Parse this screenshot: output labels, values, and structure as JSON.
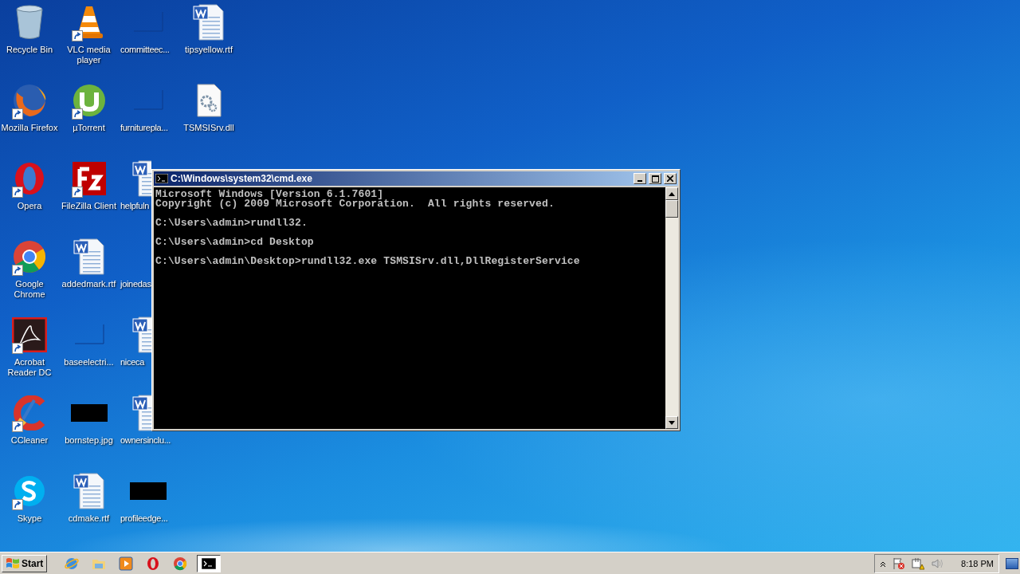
{
  "desktop": {
    "columns": [
      [
        {
          "label": "Recycle Bin",
          "kind": "recycle",
          "shortcut": false
        },
        {
          "label": "Mozilla Firefox",
          "kind": "firefox",
          "shortcut": true
        },
        {
          "label": "Opera",
          "kind": "opera",
          "shortcut": true
        },
        {
          "label": "Google Chrome",
          "kind": "chrome",
          "shortcut": true
        },
        {
          "label": "Acrobat Reader DC",
          "kind": "acrobat",
          "shortcut": true
        },
        {
          "label": "CCleaner",
          "kind": "ccleaner",
          "shortcut": true
        },
        {
          "label": "Skype",
          "kind": "skype",
          "shortcut": true
        }
      ],
      [
        {
          "label": "VLC media player",
          "kind": "vlc",
          "shortcut": true
        },
        {
          "label": "µTorrent",
          "kind": "utorrent",
          "shortcut": true
        },
        {
          "label": "FileZilla Client",
          "kind": "filezilla",
          "shortcut": true
        },
        {
          "label": "addedmark.rtf",
          "kind": "word",
          "shortcut": false
        },
        {
          "label": "baseelectri...",
          "kind": "blank",
          "shortcut": false
        },
        {
          "label": "bornstep.jpg",
          "kind": "image",
          "shortcut": false
        },
        {
          "label": "cdmake.rtf",
          "kind": "word",
          "shortcut": false
        }
      ],
      [
        {
          "label": "committeec...",
          "kind": "blank",
          "shortcut": false
        },
        {
          "label": "furniturepla...",
          "kind": "blank",
          "shortcut": false
        },
        {
          "label": "helpfuln",
          "kind": "word",
          "shortcut": false
        },
        {
          "label": "joinedas",
          "shortcut": false
        },
        {
          "label": "niceca",
          "kind": "word",
          "shortcut": false
        },
        {
          "label": "ownersinclu...",
          "kind": "word",
          "shortcut": false
        },
        {
          "label": "profileedge...",
          "kind": "image",
          "shortcut": false
        }
      ],
      [
        {
          "label": "tipsyellow.rtf",
          "kind": "word",
          "shortcut": false
        },
        {
          "label": "TSMSISrv.dll",
          "kind": "dll",
          "shortcut": false
        }
      ]
    ]
  },
  "console_window": {
    "title": "C:\\Windows\\system32\\cmd.exe",
    "blocks": [
      [
        "Microsoft Windows [Version 6.1.7601]",
        "Copyright (c) 2009 Microsoft Corporation.  All rights reserved."
      ],
      [
        "C:\\Users\\admin>rundll32."
      ],
      [
        "C:\\Users\\admin>cd Desktop"
      ],
      [
        "C:\\Users\\admin\\Desktop>rundll32.exe TSMSISrv.dll,DllRegisterService"
      ]
    ]
  },
  "taskbar": {
    "start": "Start",
    "apps": [
      {
        "kind": "ie",
        "active": false
      },
      {
        "kind": "explorer",
        "active": false
      },
      {
        "kind": "media",
        "active": false
      },
      {
        "kind": "opera",
        "active": false
      },
      {
        "kind": "chrome",
        "active": false
      },
      {
        "kind": "cmd",
        "active": true
      }
    ],
    "tray": [
      {
        "kind": "chevron"
      },
      {
        "kind": "flag"
      },
      {
        "kind": "network"
      },
      {
        "kind": "speaker"
      }
    ],
    "clock": "8:18 PM"
  }
}
